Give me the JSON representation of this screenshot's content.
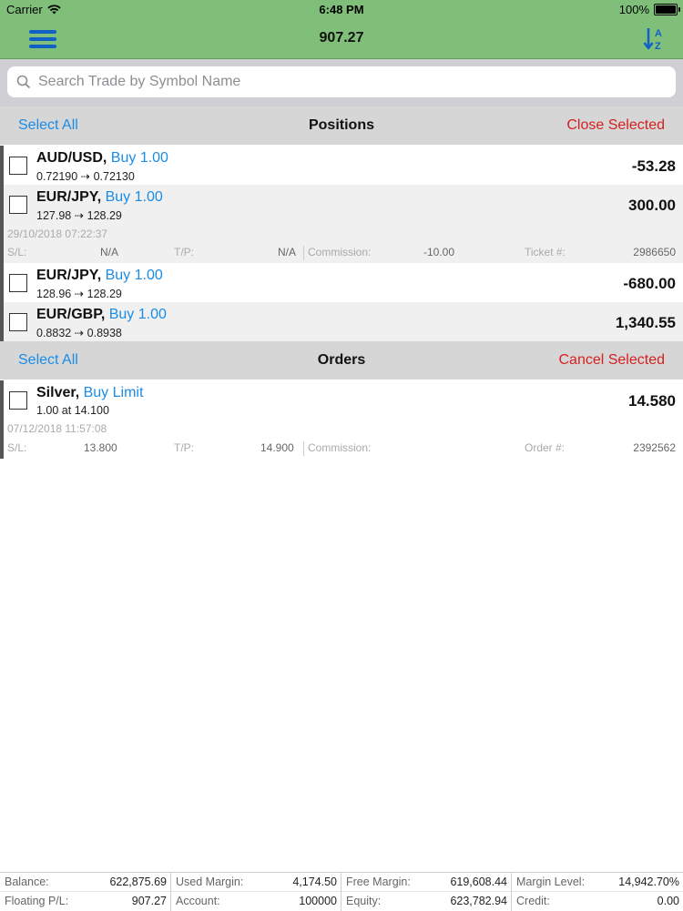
{
  "status": {
    "carrier": "Carrier",
    "time": "6:48 PM",
    "battery": "100%"
  },
  "nav": {
    "title": "907.27",
    "menu_icon": "hamburger-icon",
    "sort_icon": "sort-az-icon"
  },
  "search": {
    "placeholder": "Search Trade by Symbol Name",
    "value": ""
  },
  "positions": {
    "header": {
      "select_all": "Select All",
      "title": "Positions",
      "action": "Close Selected"
    },
    "rows": [
      {
        "symbol": "AUD/USD,",
        "side": "Buy 1.00",
        "prices": "0.72190 ⇢ 0.72130",
        "pl": "-53.28"
      },
      {
        "symbol": "EUR/JPY,",
        "side": "Buy 1.00",
        "prices": "127.98 ⇢ 128.29",
        "pl": "300.00",
        "date": "29/10/2018 07:22:37",
        "details": {
          "sl_label": "S/L:",
          "sl": "N/A",
          "tp_label": "T/P:",
          "tp": "N/A",
          "commission_label": "Commission:",
          "commission": "-10.00",
          "ticket_label": "Ticket #:",
          "ticket": "2986650"
        }
      },
      {
        "symbol": "EUR/JPY,",
        "side": "Buy 1.00",
        "prices": "128.96 ⇢ 128.29",
        "pl": "-680.00"
      },
      {
        "symbol": "EUR/GBP,",
        "side": "Buy 1.00",
        "prices": "0.8832 ⇢ 0.8938",
        "pl": "1,340.55"
      }
    ]
  },
  "orders": {
    "header": {
      "select_all": "Select All",
      "title": "Orders",
      "action": "Cancel Selected"
    },
    "rows": [
      {
        "symbol": "Silver,",
        "side": "Buy Limit",
        "prices": "1.00 at 14.100",
        "pl": "14.580",
        "date": "07/12/2018 11:57:08",
        "details": {
          "sl_label": "S/L:",
          "sl": "13.800",
          "tp_label": "T/P:",
          "tp": "14.900",
          "commission_label": "Commission:",
          "commission": "",
          "order_label": "Order #:",
          "order": "2392562"
        }
      }
    ]
  },
  "footer": {
    "balance_label": "Balance:",
    "balance": "622,875.69",
    "used_margin_label": "Used Margin:",
    "used_margin": "4,174.50",
    "free_margin_label": "Free Margin:",
    "free_margin": "619,608.44",
    "margin_level_label": "Margin Level:",
    "margin_level": "14,942.70%",
    "floating_pl_label": "Floating P/L:",
    "floating_pl": "907.27",
    "account_label": "Account:",
    "account": "100000",
    "equity_label": "Equity:",
    "equity": "623,782.94",
    "credit_label": "Credit:",
    "credit": "0.00"
  },
  "colors": {
    "header_green": "#7fbf7a",
    "link_blue": "#1a8ce8",
    "danger_red": "#d62020"
  }
}
